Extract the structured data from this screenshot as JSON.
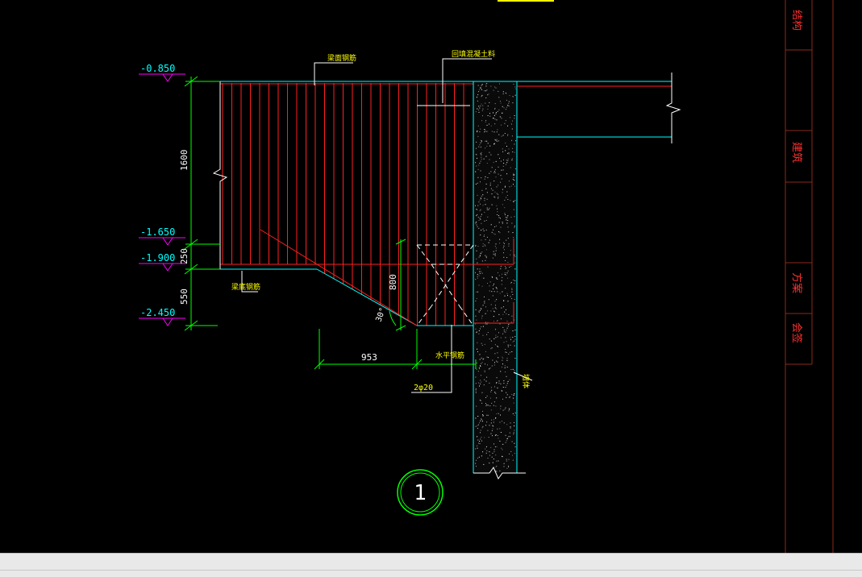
{
  "drawing": {
    "elevations": [
      "-0.850",
      "-1.650",
      "-1.900",
      "-2.450"
    ],
    "dimensions": {
      "height_main": "1600",
      "height_mid": "250",
      "height_bottom": "550",
      "width_bottom": "953",
      "slope_depth": "800",
      "angle": "30°"
    },
    "labels": {
      "top_rebar": "梁面钢筋",
      "top_right": "回填混凝土料",
      "bottom_rebar": "梁底钢筋",
      "horizontal": "水平钢筋",
      "bar_spec": "2φ20",
      "wall": "墙体"
    },
    "detail_number": "1",
    "title_block": [
      "结构",
      "建筑",
      "方案",
      "会签"
    ]
  },
  "colors": {
    "background": "#000000",
    "rebar": "#ff2020",
    "dimension": "#00ff00",
    "elevation": "#ff00ff",
    "elevation_text": "#00ffff",
    "outline": "#00ffff",
    "label": "#ffff00",
    "title_border": "#8a2a1a",
    "title_text": "#ff3030"
  }
}
